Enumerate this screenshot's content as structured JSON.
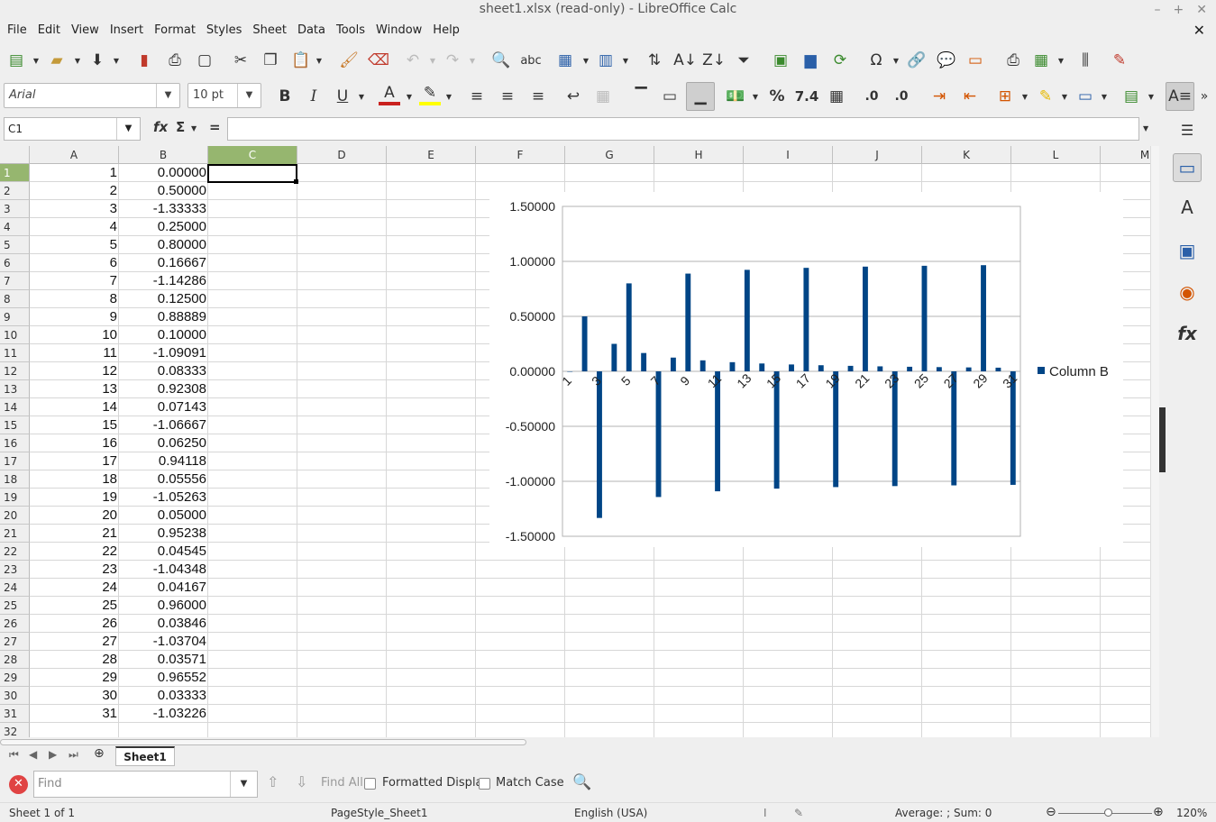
{
  "window": {
    "title": "sheet1.xlsx (read-only) - LibreOffice Calc"
  },
  "menu": [
    "File",
    "Edit",
    "View",
    "Insert",
    "Format",
    "Styles",
    "Sheet",
    "Data",
    "Tools",
    "Window",
    "Help"
  ],
  "toolbar": {
    "font_name": "Arial",
    "font_size": "10 pt"
  },
  "formula_bar": {
    "name_box": "C1",
    "value": ""
  },
  "columns": [
    "A",
    "B",
    "C",
    "D",
    "E",
    "F",
    "G",
    "H",
    "I",
    "J",
    "K",
    "L",
    "M"
  ],
  "rows": [
    [
      "1",
      "0.00000"
    ],
    [
      "2",
      "0.50000"
    ],
    [
      "3",
      "-1.33333"
    ],
    [
      "4",
      "0.25000"
    ],
    [
      "5",
      "0.80000"
    ],
    [
      "6",
      "0.16667"
    ],
    [
      "7",
      "-1.14286"
    ],
    [
      "8",
      "0.12500"
    ],
    [
      "9",
      "0.88889"
    ],
    [
      "10",
      "0.10000"
    ],
    [
      "11",
      "-1.09091"
    ],
    [
      "12",
      "0.08333"
    ],
    [
      "13",
      "0.92308"
    ],
    [
      "14",
      "0.07143"
    ],
    [
      "15",
      "-1.06667"
    ],
    [
      "16",
      "0.06250"
    ],
    [
      "17",
      "0.94118"
    ],
    [
      "18",
      "0.05556"
    ],
    [
      "19",
      "-1.05263"
    ],
    [
      "20",
      "0.05000"
    ],
    [
      "21",
      "0.95238"
    ],
    [
      "22",
      "0.04545"
    ],
    [
      "23",
      "-1.04348"
    ],
    [
      "24",
      "0.04167"
    ],
    [
      "25",
      "0.96000"
    ],
    [
      "26",
      "0.03846"
    ],
    [
      "27",
      "-1.03704"
    ],
    [
      "28",
      "0.03571"
    ],
    [
      "29",
      "0.96552"
    ],
    [
      "30",
      "0.03333"
    ],
    [
      "31",
      "-1.03226"
    ]
  ],
  "row_count": 32,
  "chart_data": {
    "type": "bar",
    "categories": [
      1,
      2,
      3,
      4,
      5,
      6,
      7,
      8,
      9,
      10,
      11,
      12,
      13,
      14,
      15,
      16,
      17,
      18,
      19,
      20,
      21,
      22,
      23,
      24,
      25,
      26,
      27,
      28,
      29,
      30,
      31
    ],
    "x_tick_labels": [
      "1",
      "3",
      "5",
      "7",
      "9",
      "11",
      "13",
      "15",
      "17",
      "19",
      "21",
      "23",
      "25",
      "27",
      "29",
      "31"
    ],
    "series": [
      {
        "name": "Column B",
        "color": "#004586",
        "values": [
          0,
          0.5,
          -1.33333,
          0.25,
          0.8,
          0.16667,
          -1.14286,
          0.125,
          0.88889,
          0.1,
          -1.09091,
          0.08333,
          0.92308,
          0.07143,
          -1.06667,
          0.0625,
          0.94118,
          0.05556,
          -1.05263,
          0.05,
          0.95238,
          0.04545,
          -1.04348,
          0.04167,
          0.96,
          0.03846,
          -1.03704,
          0.03571,
          0.96552,
          0.03333,
          -1.03226
        ]
      }
    ],
    "y_tick_labels": [
      "1.50000",
      "1.00000",
      "0.50000",
      "0.00000",
      "-0.50000",
      "-1.00000",
      "-1.50000"
    ],
    "ylim": [
      -1.5,
      1.5
    ],
    "legend": "right",
    "grid": true
  },
  "sheet_tabs": [
    "Sheet1"
  ],
  "find_bar": {
    "placeholder": "Find",
    "find_all": "Find All",
    "formatted_display": "Formatted Display",
    "match_case": "Match Case"
  },
  "status": {
    "sheet": "Sheet 1 of 1",
    "page_style": "PageStyle_Sheet1",
    "language": "English (USA)",
    "summary": "Average: ; Sum: 0",
    "zoom": "120%"
  }
}
